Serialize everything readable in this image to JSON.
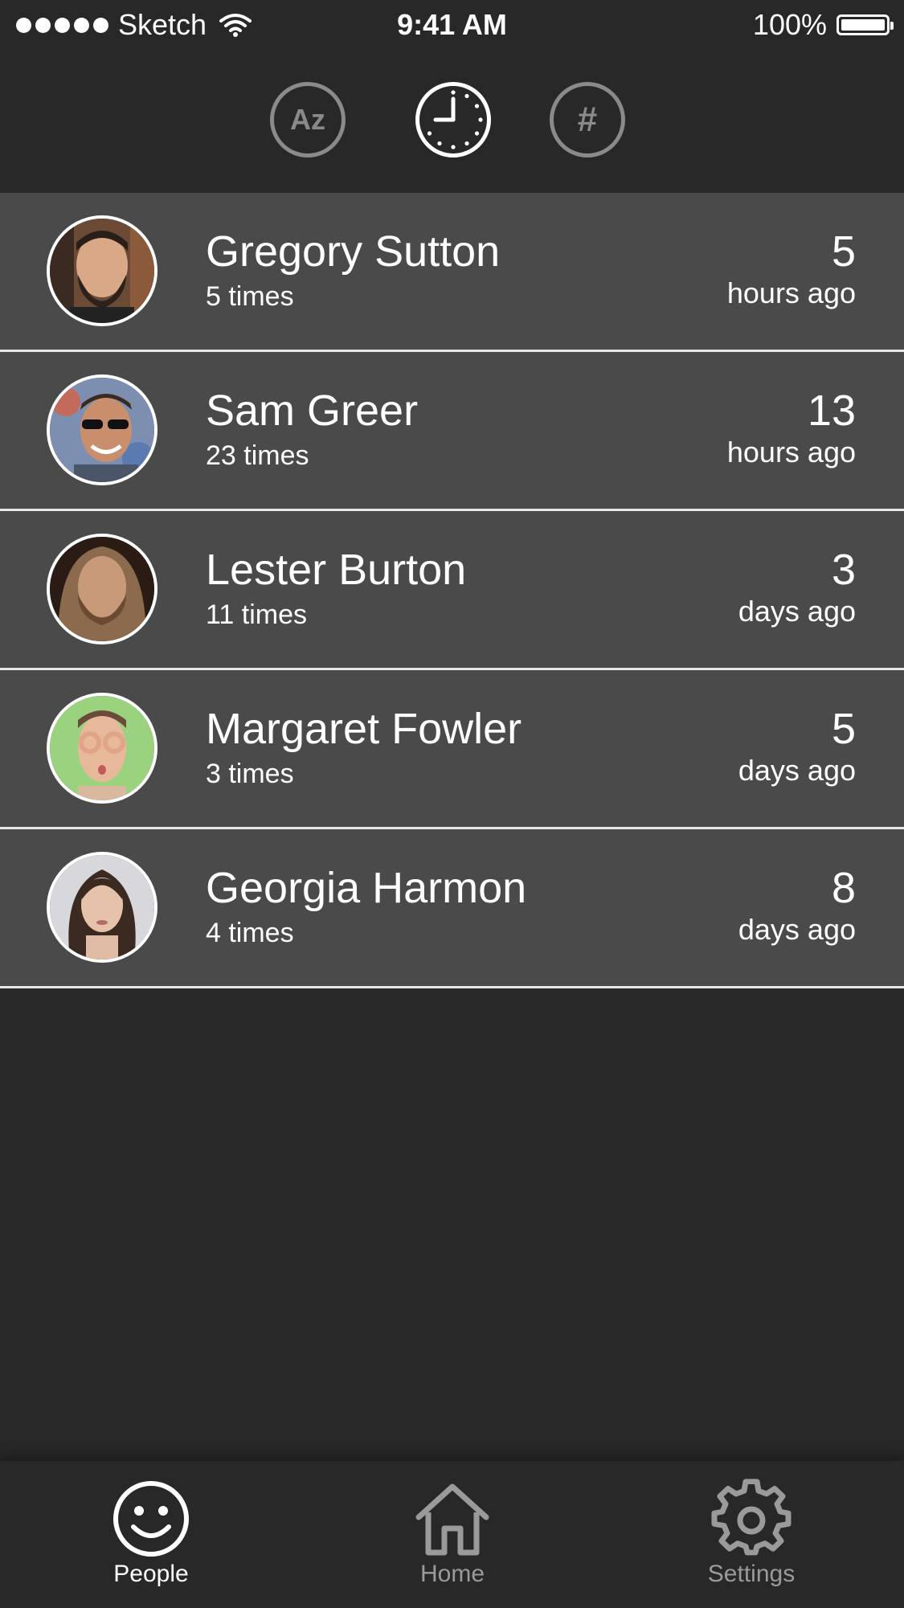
{
  "status_bar": {
    "carrier": "Sketch",
    "time": "9:41 AM",
    "battery": "100%"
  },
  "sort_options": {
    "alphabetical_label": "Az",
    "count_label": "#",
    "selected": "recent"
  },
  "people": [
    {
      "name": "Gregory Sutton",
      "count": "5 times",
      "ago_value": "5",
      "ago_unit": "hours ago"
    },
    {
      "name": "Sam Greer",
      "count": "23 times",
      "ago_value": "13",
      "ago_unit": "hours ago"
    },
    {
      "name": "Lester Burton",
      "count": "11 times",
      "ago_value": "3",
      "ago_unit": "days ago"
    },
    {
      "name": "Margaret Fowler",
      "count": "3 times",
      "ago_value": "5",
      "ago_unit": "days ago"
    },
    {
      "name": "Georgia Harmon",
      "count": "4 times",
      "ago_value": "8",
      "ago_unit": "days ago"
    }
  ],
  "tab_bar": {
    "people_label": "People",
    "home_label": "Home",
    "settings_label": "Settings",
    "selected": "People"
  },
  "colors": {
    "background": "#282828",
    "row_background": "#4a4a4a",
    "divider": "#e6e6e6",
    "inactive": "#8a8a8a"
  }
}
